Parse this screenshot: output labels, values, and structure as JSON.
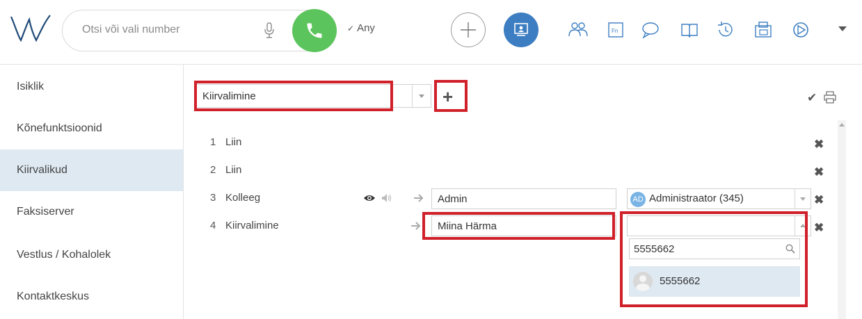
{
  "header": {
    "search_placeholder": "Otsi või vali number",
    "line_select": "Any",
    "icons": [
      "logo-icon",
      "microphone-icon",
      "phone-icon",
      "chevron-down-icon",
      "plus-icon",
      "desktop-icon",
      "contacts-icon",
      "function-keys-icon",
      "chat-icon",
      "book-icon",
      "history-icon",
      "fax-icon",
      "presence-icon",
      "menu-dropdown-icon"
    ]
  },
  "sidebar": {
    "items": [
      {
        "label": "Isiklik"
      },
      {
        "label": "Kõnefunktsioonid"
      },
      {
        "label": "Kiirvalikud",
        "active": true
      },
      {
        "label": "Faksiserver"
      },
      {
        "label": "Vestlus / Kohalolek"
      },
      {
        "label": "Kontaktkeskus"
      }
    ]
  },
  "main": {
    "profile_select": "Kiirvalimine",
    "add_label": "+",
    "rows": [
      {
        "num": "1",
        "type": "Liin"
      },
      {
        "num": "2",
        "type": "Liin"
      },
      {
        "num": "3",
        "type": "Kolleeg",
        "name": "Admin",
        "user_badge": "AD",
        "user": "Administraator (345)"
      },
      {
        "num": "4",
        "type": "Kiirvalimine",
        "name": "Miina Härma",
        "user": ""
      }
    ],
    "dropdown": {
      "search_value": "5555662",
      "option": "5555662"
    }
  },
  "colors": {
    "accent_blue": "#3d7ec2",
    "call_green": "#5cc45c",
    "highlight_red": "#d0202a",
    "active_bg": "#dfe9f2"
  }
}
